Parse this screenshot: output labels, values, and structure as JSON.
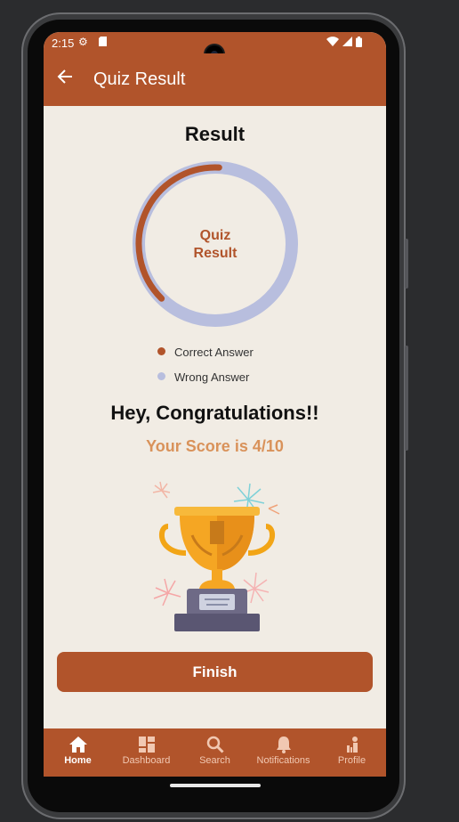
{
  "status_bar": {
    "time": "2:15"
  },
  "app_bar": {
    "title": "Quiz Result"
  },
  "result": {
    "heading": "Result",
    "chart_center_label_line1": "Quiz",
    "chart_center_label_line2": "Result",
    "correct_fraction": 0.4,
    "legend": [
      {
        "label": "Correct Answer",
        "color": "#b1542b"
      },
      {
        "label": "Wrong Answer",
        "color": "#b8bede"
      }
    ],
    "congrats": "Hey, Congratulations!!",
    "score_text": "Your Score is 4/10"
  },
  "finish_button": {
    "label": "Finish"
  },
  "bottom_nav": {
    "items": [
      {
        "label": "Home",
        "icon": "home-icon",
        "active": true
      },
      {
        "label": "Dashboard",
        "icon": "dashboard-icon",
        "active": false
      },
      {
        "label": "Search",
        "icon": "search-icon",
        "active": false
      },
      {
        "label": "Notifications",
        "icon": "bell-icon",
        "active": false
      },
      {
        "label": "Profile",
        "icon": "profile-icon",
        "active": false
      }
    ]
  },
  "colors": {
    "primary": "#b1542b",
    "background": "#f1ece4",
    "wrong": "#b8bede",
    "score": "#d9925a"
  }
}
